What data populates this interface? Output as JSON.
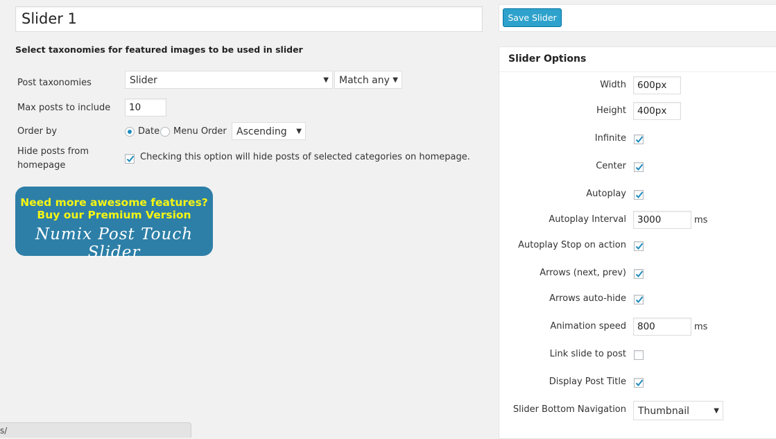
{
  "slider_title": "Slider 1",
  "section_heading": "Select taxonomies for featured images to be used in slider",
  "form": {
    "post_taxonomies_label": "Post taxonomies",
    "taxonomy_select": "Slider",
    "match_select": "Match any",
    "max_posts_label": "Max posts to include",
    "max_posts_value": "10",
    "order_by_label": "Order by",
    "order_by_date": "Date",
    "order_by_menu": "Menu Order",
    "order_direction": "Ascending",
    "hide_posts_label_1": "Hide posts from",
    "hide_posts_label_2": "homepage",
    "hide_posts_checked": true,
    "hide_posts_text": "Checking this option will hide posts of selected categories on homepage."
  },
  "promo": {
    "line1": "Need more awesome features?",
    "line2": "Buy our Premium Version",
    "line3": "Numix Post Touch Slider"
  },
  "save_button": "Save Slider",
  "options": {
    "title": "Slider Options",
    "width_label": "Width",
    "width_value": "600px",
    "height_label": "Height",
    "height_value": "400px",
    "infinite_label": "Infinite",
    "infinite_checked": true,
    "center_label": "Center",
    "center_checked": true,
    "autoplay_label": "Autoplay",
    "autoplay_checked": true,
    "autoplay_interval_label": "Autoplay Interval",
    "autoplay_interval_value": "3000",
    "ms_unit": "ms",
    "autoplay_stop_label": "Autoplay Stop on action",
    "autoplay_stop_checked": true,
    "arrows_label": "Arrows (next, prev)",
    "arrows_checked": true,
    "arrows_autohide_label": "Arrows auto-hide",
    "arrows_autohide_checked": true,
    "animation_speed_label": "Animation speed",
    "animation_speed_value": "800",
    "link_slide_label": "Link slide to post",
    "link_slide_checked": false,
    "display_title_label": "Display Post Title",
    "display_title_checked": true,
    "bottom_nav_label": "Slider Bottom Navigation",
    "bottom_nav_value": "Thumbnail"
  },
  "status_bar_text": "s/",
  "colors": {
    "accent": "#2ea2cc",
    "check": "#1e8cbe",
    "promo_bg": "#2d7fa7",
    "promo_text": "#f5f514"
  }
}
